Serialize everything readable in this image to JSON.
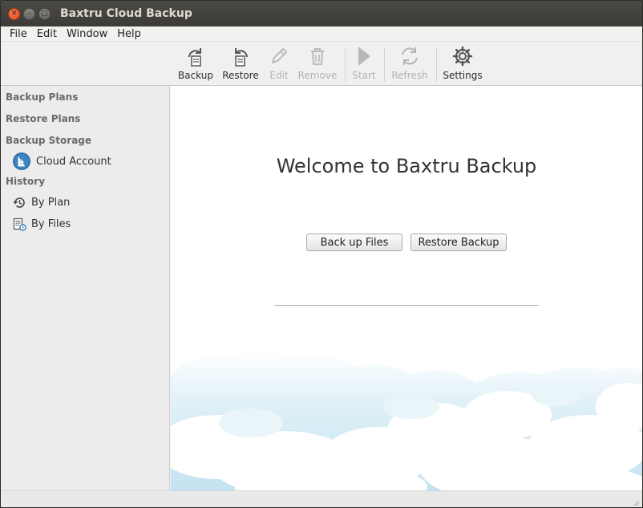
{
  "window": {
    "title": "Baxtru Cloud Backup"
  },
  "menu": [
    "File",
    "Edit",
    "Window",
    "Help"
  ],
  "toolbar": {
    "backup": "Backup",
    "restore": "Restore",
    "edit": "Edit",
    "remove": "Remove",
    "start": "Start",
    "refresh": "Refresh",
    "settings": "Settings"
  },
  "sidebar": {
    "backup_plans": "Backup Plans",
    "restore_plans": "Restore Plans",
    "backup_storage": "Backup Storage",
    "cloud_account": "Cloud Account",
    "history": "History",
    "by_plan": "By Plan",
    "by_files": "By Files"
  },
  "main": {
    "welcome": "Welcome to Baxtru Backup",
    "backup_files_button": "Back up Files",
    "restore_backup_button": "Restore Backup"
  },
  "colors": {
    "titlebar": "#3c3b37",
    "close_button": "#df4a16",
    "disabled_text": "#b2b2b2",
    "cloud_sky": "#cfe8f3"
  }
}
